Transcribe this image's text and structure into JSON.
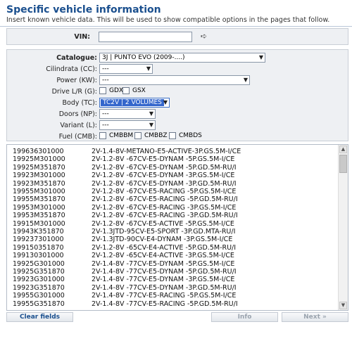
{
  "header": {
    "title": "Specific vehicle information",
    "subtitle": "Insert known vehicle data. This will be used to show compatible options in the pages that follow."
  },
  "vin": {
    "label": "VIN:",
    "value": "",
    "go_icon": "arrow-right-icon"
  },
  "form": {
    "catalogue": {
      "label": "Catalogue:",
      "value": "3J | PUNTO EVO (2009-....)"
    },
    "cilindrata": {
      "label": "Cilindrata (CC):",
      "value": "---"
    },
    "power": {
      "label": "Power (KW):",
      "value": "---"
    },
    "drive": {
      "label": "Drive L/R (G):",
      "options": [
        "GDX",
        "GSX"
      ]
    },
    "body": {
      "label": "Body (TC):",
      "value": "TC2V | 2 VOLUMES"
    },
    "doors": {
      "label": "Doors (NP):",
      "value": "---"
    },
    "variant": {
      "label": "Variant (L):",
      "value": "---"
    },
    "fuel": {
      "label": "Fuel (CMB):",
      "options": [
        "CMBBM",
        "CMBBZ",
        "CMBDS"
      ]
    }
  },
  "results": [
    {
      "code": "199636301000",
      "desc": "2V-1.4-8V-METANO-E5-ACTIVE-3P.GS.5M-I/CE"
    },
    {
      "code": "19925M301000",
      "desc": "2V-1.2-8V -67CV-E5-DYNAM  -5P.GS.5M-I/CE"
    },
    {
      "code": "19925M351870",
      "desc": "2V-1.2-8V -67CV-E5-DYNAM  -5P.GD.5M-RU/I"
    },
    {
      "code": "19923M301000",
      "desc": "2V-1.2-8V -67CV-E5-DYNAM  -3P.GS.5M-I/CE"
    },
    {
      "code": "19923M351870",
      "desc": "2V-1.2-8V -67CV-E5-DYNAM  -3P.GD.5M-RU/I"
    },
    {
      "code": "19955M301000",
      "desc": "2V-1.2-8V -67CV-E5-RACING -5P.GS.5M-I/CE"
    },
    {
      "code": "19955M351870",
      "desc": "2V-1.2-8V -67CV-E5-RACING -5P.GD.5M-RU/I"
    },
    {
      "code": "19953M301000",
      "desc": "2V-1.2-8V -67CV-E5-RACING -3P.GS.5M-I/CE"
    },
    {
      "code": "19953M351870",
      "desc": "2V-1.2-8V -67CV-E5-RACING -3P.GD.5M-RU/I"
    },
    {
      "code": "19915M301000",
      "desc": "2V-1.2-8V -67CV-E5-ACTIVE -5P.GS.5M-I/CE"
    },
    {
      "code": "19943K351870",
      "desc": "2V-1.3JTD-95CV-E5-SPORT  -3P.GD.MTA-RU/I"
    },
    {
      "code": "199237301000",
      "desc": "2V-1.3JTD-90CV-E4-DYNAM  -3P.GS.5M-I/CE"
    },
    {
      "code": "199150351870",
      "desc": "2V-1.2-8V -65CV-E4-ACTIVE -5P.GD.5M-RU/I"
    },
    {
      "code": "199130301000",
      "desc": "2V-1.2-8V -65CV-E4-ACTIVE -3P.GS.5M-I/CE"
    },
    {
      "code": "19925G301000",
      "desc": "2V-1.4-8V -77CV-E5-DYNAM  -5P.GS.5M-I/CE"
    },
    {
      "code": "19925G351870",
      "desc": "2V-1.4-8V -77CV-E5-DYNAM  -5P.GD.5M-RU/I"
    },
    {
      "code": "19923G301000",
      "desc": "2V-1.4-8V -77CV-E5-DYNAM  -3P.GS.5M-I/CE"
    },
    {
      "code": "19923G351870",
      "desc": "2V-1.4-8V -77CV-E5-DYNAM  -3P.GD.5M-RU/I"
    },
    {
      "code": "19955G301000",
      "desc": "2V-1.4-8V -77CV-E5-RACING -5P.GS.5M-I/CE"
    },
    {
      "code": "19955G351870",
      "desc": "2V-1.4-8V -77CV-E5-RACING -5P.GD.5M-RU/I"
    }
  ],
  "footer": {
    "clear_label": "Clear fields",
    "info_label": "Info",
    "next_label": "Next »"
  }
}
